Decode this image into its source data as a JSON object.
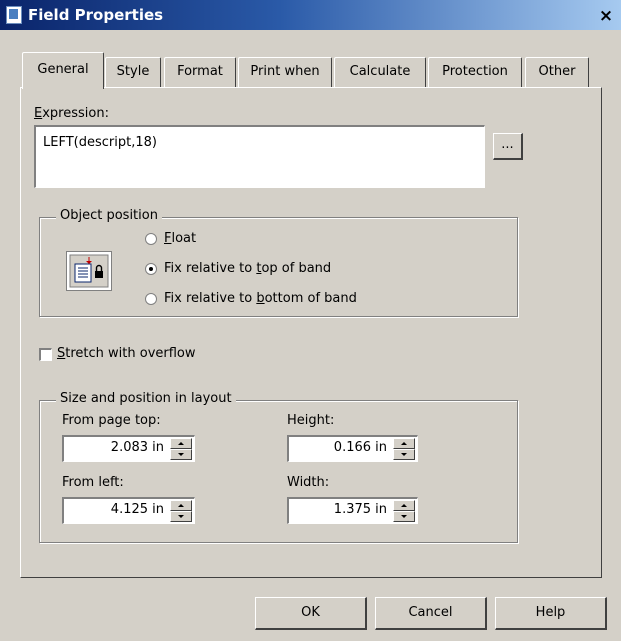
{
  "window": {
    "title": "Field Properties",
    "close_symbol": "×"
  },
  "tabs": [
    {
      "label": "General"
    },
    {
      "label": "Style"
    },
    {
      "label": "Format"
    },
    {
      "label": "Print when"
    },
    {
      "label": "Calculate"
    },
    {
      "label": "Protection"
    },
    {
      "label": "Other"
    }
  ],
  "general": {
    "expression_label_first": "E",
    "expression_label_rest": "xpression:",
    "expression_value": "LEFT(descript,18)",
    "browse_label": "...",
    "object_position": {
      "title": "Object position",
      "icon": "object-position-icon",
      "options": [
        {
          "prefix": "",
          "u": "F",
          "suffix": "loat",
          "checked": false
        },
        {
          "prefix": "Fix relative to ",
          "u": "t",
          "suffix": "op of band",
          "checked": true
        },
        {
          "prefix": "Fix relative to ",
          "u": "b",
          "suffix": "ottom of band",
          "checked": false
        }
      ]
    },
    "stretch": {
      "u": "S",
      "suffix": "tretch with overflow",
      "checked": false
    },
    "size_position": {
      "title": "Size and position in layout",
      "from_page_top": {
        "label": "From page top:",
        "value": "2.083 in"
      },
      "height": {
        "label": "Height:",
        "value": "0.166 in"
      },
      "from_left": {
        "label": "From left:",
        "value": "4.125 in"
      },
      "width": {
        "label": "Width:",
        "value": "1.375 in"
      }
    }
  },
  "footer": {
    "ok_label": "OK",
    "cancel_label": "Cancel",
    "help_label": "Help"
  }
}
